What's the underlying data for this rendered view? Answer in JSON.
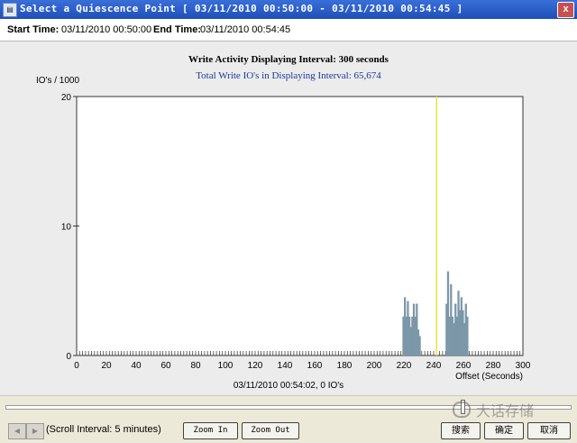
{
  "window": {
    "title": "Select a Quiescence Point [ 03/11/2010 00:50:00 - 03/11/2010 00:54:45 ]",
    "app_icon": "window-icon",
    "close_label": "x"
  },
  "times": {
    "start_label": "Start Time:",
    "start_value": "03/11/2010 00:50:00",
    "end_label": "End Time:",
    "end_value": "03/11/2010 00:54:45"
  },
  "chart_header": {
    "title": "Write Activity Displaying Interval: 300 seconds",
    "subtitle": "Total Write IO's in Displaying Interval: 65,674"
  },
  "status": {
    "cursor_readout": "03/11/2010 00:54:02,  0 IO's"
  },
  "chart_data": {
    "type": "bar",
    "title": "Write Activity Displaying Interval: 300 seconds",
    "subtitle": "Total Write IO's in Displaying Interval: 65,674",
    "ylabel": "IO's / 1000",
    "xlabel": "Offset (Seconds)",
    "xlim": [
      0,
      300
    ],
    "ylim": [
      0,
      20
    ],
    "yticks": [
      0,
      10,
      20
    ],
    "xticks": [
      0,
      20,
      40,
      60,
      80,
      100,
      120,
      140,
      160,
      180,
      200,
      220,
      240,
      260,
      280,
      300
    ],
    "grid": false,
    "cursor_x": 242,
    "bar_color": "#7b97a8",
    "cursor_color": "#e8e23a",
    "x": [
      219,
      220,
      221,
      222,
      223,
      224,
      225,
      226,
      227,
      228,
      229,
      230,
      248,
      249,
      250,
      251,
      252,
      253,
      254,
      255,
      256,
      257,
      258,
      259,
      260,
      261,
      262
    ],
    "values": [
      3,
      4.5,
      3,
      4.2,
      3,
      2.2,
      3,
      4,
      3,
      4,
      2,
      1.5,
      4,
      6.5,
      3,
      5.5,
      3,
      2.5,
      4,
      3,
      5,
      3.5,
      4.5,
      3.5,
      2.5,
      4,
      3
    ]
  },
  "scroll": {
    "label": "(Scroll Interval: 5 minutes)"
  },
  "buttons": {
    "zoom_in": "Zoom In",
    "zoom_out": "Zoom Out",
    "search": "搜索",
    "ok": "确定",
    "cancel": "取消"
  },
  "watermark": {
    "text": "大话存储"
  }
}
